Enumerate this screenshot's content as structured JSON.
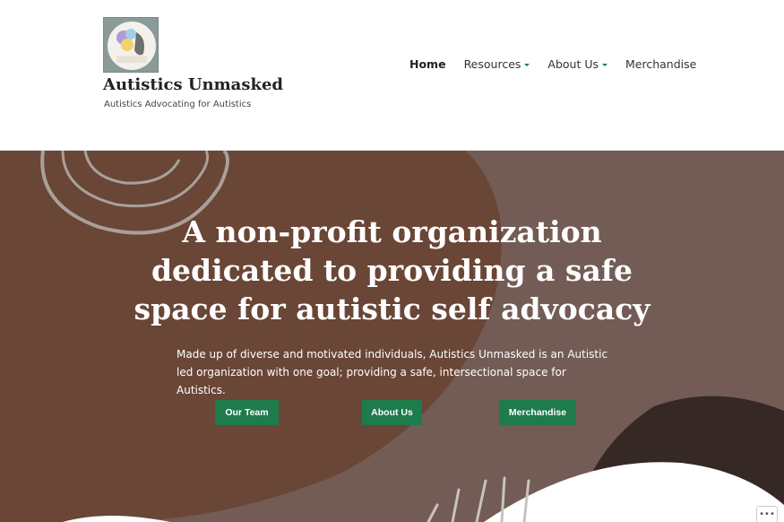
{
  "site": {
    "title": "Autistics Unmasked",
    "tagline": "Autistics Advocating for Autistics",
    "logo_icon": "autistics-unmasked-logo"
  },
  "nav": {
    "items": [
      {
        "label": "Home",
        "active": true,
        "has_dropdown": false
      },
      {
        "label": "Resources",
        "active": false,
        "has_dropdown": true
      },
      {
        "label": "About Us",
        "active": false,
        "has_dropdown": true
      },
      {
        "label": "Merchandise",
        "active": false,
        "has_dropdown": false
      }
    ]
  },
  "hero": {
    "headline_lines": [
      "A non-profit organization",
      "dedicated to providing a safe",
      "space for autistic self advocacy"
    ],
    "body": "Made up of diverse and motivated individuals, Autistics Unmasked is an Autistic led organization with one goal; providing a safe, intersectional space for Autistics.",
    "buttons": [
      {
        "label": "Our Team"
      },
      {
        "label": "About Us"
      },
      {
        "label": "Merchandise"
      }
    ]
  },
  "widgets": {
    "more_label": "•••"
  },
  "colors": {
    "accent": "#1e7b4b",
    "hero_bg": "#735c55",
    "hero_blob": "#6a4636",
    "dark_blob": "#352825"
  }
}
